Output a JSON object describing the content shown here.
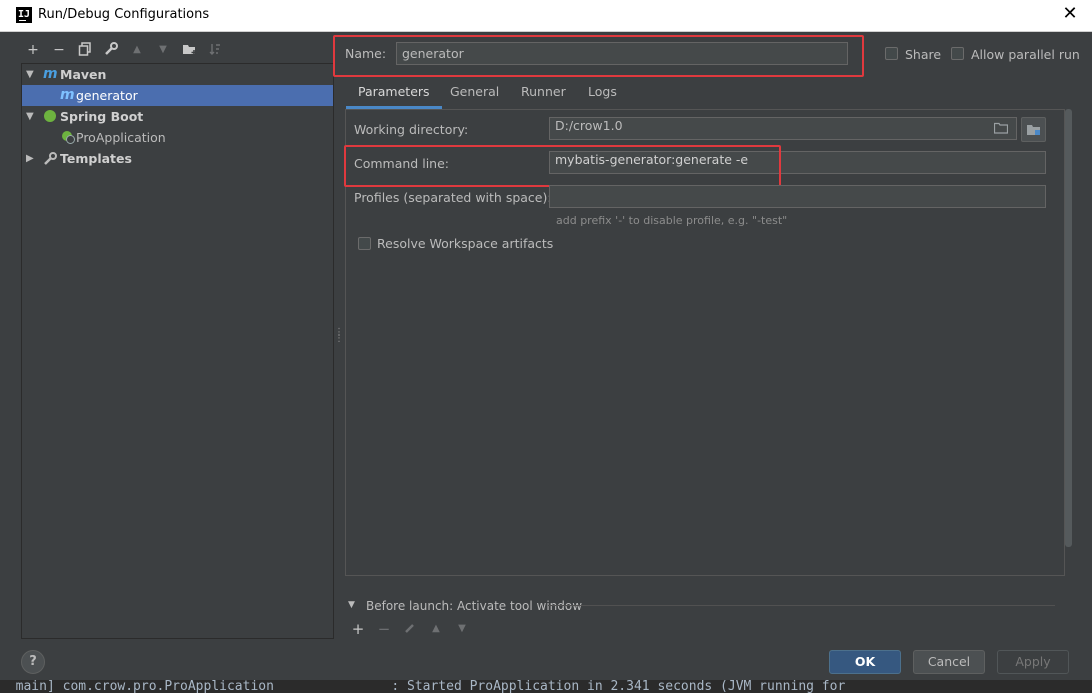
{
  "window": {
    "title": "Run/Debug Configurations",
    "app_icon_text": "IJ"
  },
  "toolbar": {
    "items": [
      "add-icon",
      "remove-icon",
      "copy-icon",
      "edit-templates-icon",
      "move-up-icon",
      "move-down-icon",
      "new-folder-icon",
      "sort-icon"
    ]
  },
  "tree": {
    "maven": "Maven",
    "maven_config": "generator",
    "spring_boot": "Spring Boot",
    "spring_config": "ProApplication",
    "templates": "Templates"
  },
  "name_row": {
    "label": "Name:",
    "value": "generator",
    "share_label": "Share",
    "share_checked": false,
    "parallel_label": "Allow parallel run",
    "parallel_checked": false
  },
  "tabs": [
    "Parameters",
    "General",
    "Runner",
    "Logs"
  ],
  "active_tab": "Parameters",
  "params": {
    "working_dir_label": "Working directory:",
    "working_dir_value": "D:/crow1.0",
    "cmd_label": "Command line:",
    "cmd_value": "mybatis-generator:generate -e",
    "profiles_label": "Profiles (separated with space):",
    "profiles_value": "",
    "profiles_hint": "add prefix '-' to disable profile, e.g. \"-test\"",
    "resolve_label": "Resolve Workspace artifacts",
    "resolve_checked": false
  },
  "before_launch": {
    "text": "Before launch: Activate tool window"
  },
  "buttons": {
    "help": "?",
    "ok": "OK",
    "cancel": "Cancel",
    "apply": "Apply"
  },
  "background_log": "  main] com.crow.pro.ProApplication               : Started ProApplication in 2.341 seconds (JVM running for",
  "colors": {
    "accent": "#4b6eaf",
    "highlight_box": "#e0393e",
    "ok_button": "#365880"
  }
}
